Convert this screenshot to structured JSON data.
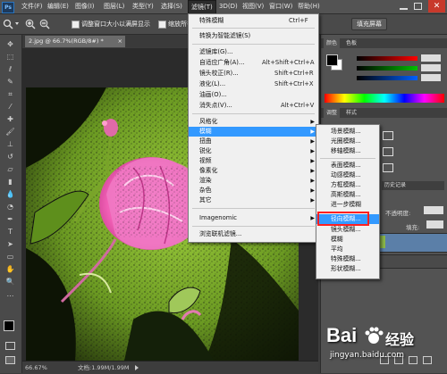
{
  "menubar": {
    "app_icon": "Ps",
    "items": [
      "文件(F)",
      "编辑(E)",
      "图像(I)",
      "图层(L)",
      "类型(Y)",
      "选择(S)",
      "滤镜(T)",
      "3D(D)",
      "视图(V)",
      "窗口(W)",
      "帮助(H)"
    ]
  },
  "optionsbar": {
    "resize_windows_label": "调整窗口大小以满屏显示",
    "zoom_all_label": "缩放所有",
    "fill_screen_button": "填充屏幕"
  },
  "document": {
    "tab_title": "2.jpg @ 66.7%(RGB/8#) *",
    "tab_close": "×"
  },
  "statusbar": {
    "zoom": "66.67%",
    "doc_size": "文档:1.99M/1.99M"
  },
  "panels": {
    "color_tabs": [
      "颜色",
      "色板"
    ],
    "adjust_tabs": [
      "调整",
      "样式"
    ],
    "history_tab": "历史记录",
    "layers_partial": {
      "opacity_label": "不透明度:",
      "fill_label": "填充:",
      "lock_icon_label": "锁"
    },
    "accent_colors": {
      "red": "#ff0000",
      "green": "#00c000",
      "blue": "#0060ff"
    }
  },
  "filter_menu": {
    "items": [
      {
        "label": "特殊模糊",
        "shortcut": "Ctrl+F"
      },
      {
        "label": "转换为智能滤镜(S)",
        "shortcut": ""
      },
      {
        "label": "滤镜库(G)...",
        "shortcut": ""
      },
      {
        "label": "自适应广角(A)...",
        "shortcut": "Alt+Shift+Ctrl+A"
      },
      {
        "label": "镜头校正(R)...",
        "shortcut": "Shift+Ctrl+R"
      },
      {
        "label": "液化(L)...",
        "shortcut": "Shift+Ctrl+X"
      },
      {
        "label": "油画(O)...",
        "shortcut": ""
      },
      {
        "label": "消失点(V)...",
        "shortcut": "Alt+Ctrl+V"
      },
      {
        "label": "风格化",
        "shortcut": ""
      },
      {
        "label": "模糊",
        "shortcut": ""
      },
      {
        "label": "扭曲",
        "shortcut": ""
      },
      {
        "label": "锐化",
        "shortcut": ""
      },
      {
        "label": "视频",
        "shortcut": ""
      },
      {
        "label": "像素化",
        "shortcut": ""
      },
      {
        "label": "渲染",
        "shortcut": ""
      },
      {
        "label": "杂色",
        "shortcut": ""
      },
      {
        "label": "其它",
        "shortcut": ""
      },
      {
        "label": "Imagenomic",
        "shortcut": ""
      },
      {
        "label": "浏览联机滤镜...",
        "shortcut": ""
      }
    ]
  },
  "blur_submenu": {
    "items": [
      "场景模糊...",
      "光圈模糊...",
      "移轴模糊...",
      "表面模糊...",
      "动感模糊...",
      "方框模糊...",
      "高斯模糊...",
      "进一步模糊",
      "径向模糊...",
      "镜头模糊...",
      "模糊",
      "平均",
      "特殊模糊...",
      "形状模糊..."
    ]
  },
  "watermark": {
    "brand": "Bai",
    "brand_suffix": "经验",
    "url": "jingyan.baidu.com"
  }
}
